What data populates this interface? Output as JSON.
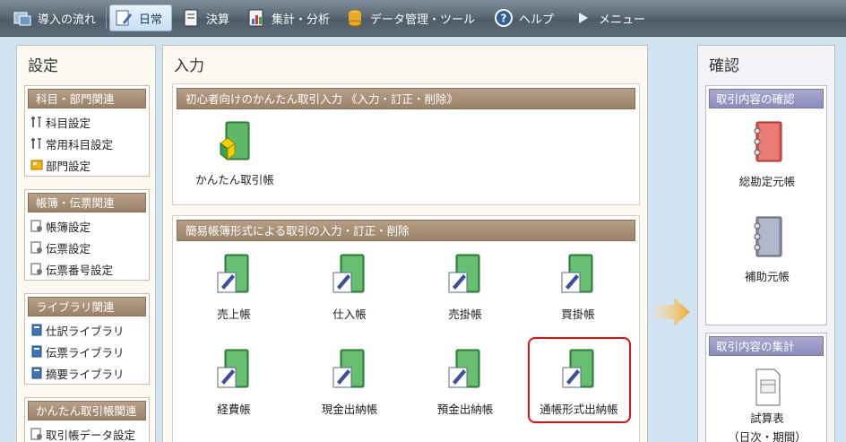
{
  "toolbar": {
    "items": [
      {
        "label": "導入の流れ",
        "icon": "intro-flow-icon"
      },
      {
        "label": "日常",
        "icon": "daily-icon",
        "active": true
      },
      {
        "label": "決算",
        "icon": "closing-icon"
      },
      {
        "label": "集計・分析",
        "icon": "analysis-icon"
      },
      {
        "label": "データ管理・ツール",
        "icon": "data-tools-icon"
      },
      {
        "label": "ヘルプ",
        "icon": "help-icon"
      },
      {
        "label": "メニュー",
        "icon": "menu-arrow-icon"
      }
    ]
  },
  "settings": {
    "title": "設定",
    "groups": [
      {
        "header": "科目・部門関連",
        "items": [
          "科目設定",
          "常用科目設定",
          "部門設定"
        ]
      },
      {
        "header": "帳簿・伝票関連",
        "items": [
          "帳簿設定",
          "伝票設定",
          "伝票番号設定"
        ]
      },
      {
        "header": "ライブラリ関連",
        "items": [
          "仕訳ライブラリ",
          "伝票ライブラリ",
          "摘要ライブラリ"
        ]
      },
      {
        "header": "かんたん取引帳関連",
        "items": [
          "取引帳データ設定"
        ]
      }
    ]
  },
  "input": {
    "title": "入力",
    "section1": {
      "header": "初心者向けのかんたん取引入力 《入力・訂正・削除》",
      "items": [
        "かんたん取引帳"
      ]
    },
    "section2": {
      "header": "簡易帳簿形式による取引の入力・訂正・削除",
      "items": [
        "売上帳",
        "仕入帳",
        "売掛帳",
        "買掛帳",
        "経費帳",
        "現金出納帳",
        "預金出納帳",
        "通帳形式出納帳"
      ]
    }
  },
  "confirm": {
    "title": "確認",
    "group1": {
      "header": "取引内容の確認",
      "items": [
        "総勘定元帳",
        "補助元帳"
      ]
    },
    "group2": {
      "header": "取引内容の集計",
      "items": [
        "試算表",
        "（日次・期間）"
      ]
    }
  },
  "colors": {
    "book_green": "#3f9a4a",
    "book_red": "#d9534f",
    "book_gray": "#8a8fa8",
    "highlight": "#dd1111",
    "arrow": "#f5a623"
  }
}
